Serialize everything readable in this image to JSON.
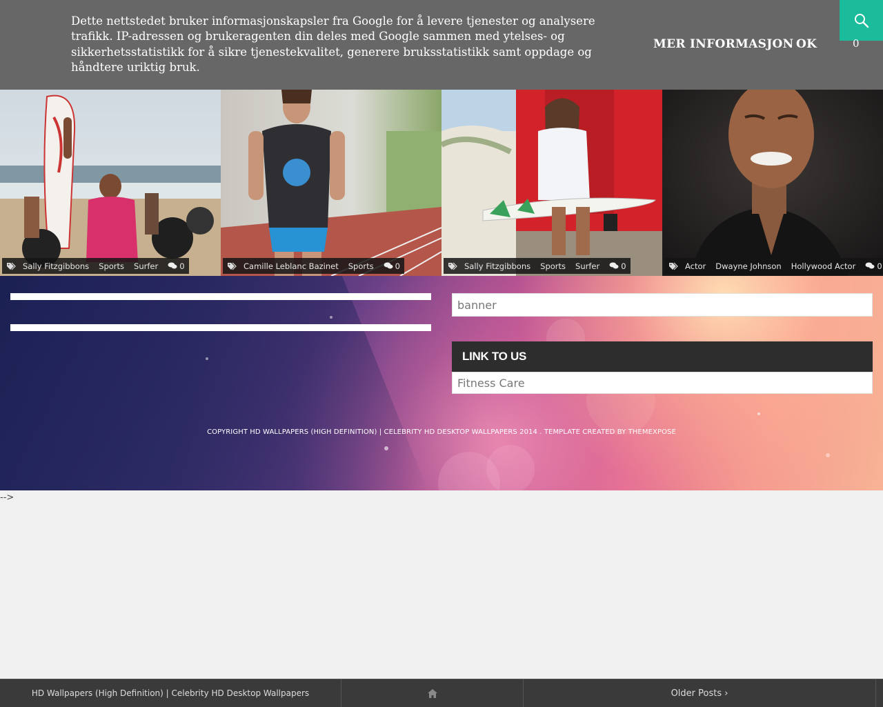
{
  "cookie": {
    "text": "Dette nettstedet bruker informasjonskapsler fra Google for å levere tjenester og analysere trafikk. IP-adressen og brukeragenten din deles med Google sammen med ytelses- og sikkerhetsstatistikk for å sikre tjenestekvalitet, generere bruksstatistikk samt oppdage og håndtere uriktig bruk.",
    "more_info": "MER INFORMASJON",
    "ok": "OK"
  },
  "header": {
    "count": "0",
    "search_icon": "search-icon"
  },
  "gallery": [
    {
      "image": "surfer-woman-holding-surfboard-beach-photo",
      "tags": [
        "Sally Fitzgibbons",
        "Sports",
        "Surfer"
      ],
      "comments": "0"
    },
    {
      "image": "athlete-woman-running-track-photo",
      "tags": [
        "Camille Leblanc Bazinet",
        "Sports"
      ],
      "comments": "0"
    },
    {
      "image": "surfer-woman-sitting-red-door-photo",
      "tags": [
        "Sally Fitzgibbons",
        "Sports",
        "Surfer"
      ],
      "comments": "0"
    },
    {
      "image": "smiling-man-black-shirt-portrait-photo",
      "tags": [
        "Actor",
        "Dwayne Johnson",
        "Hollywood Actor"
      ],
      "comments": "0"
    }
  ],
  "sidebar": {
    "banner_label": "banner",
    "link_to_us_title": "LINK TO US",
    "link_item": "Fitness Care"
  },
  "footer": {
    "copyright": "COPYRIGHT HD WALLPAPERS (HIGH DEFINITION) | CELEBRITY HD DESKTOP WALLPAPERS 2014 . TEMPLATE CREATED BY",
    "creator": "THEMEXPOSE"
  },
  "stray_text": "-->",
  "bottom_nav": {
    "site_name": "HD Wallpapers (High Definition) | Celebrity HD Desktop Wallpapers",
    "home_icon": "home-icon",
    "older_posts": "Older Posts ›"
  },
  "colors": {
    "accent": "#1bbc9b",
    "cookie_bg": "#676767",
    "widget_title_bg": "#2d2d2d"
  }
}
